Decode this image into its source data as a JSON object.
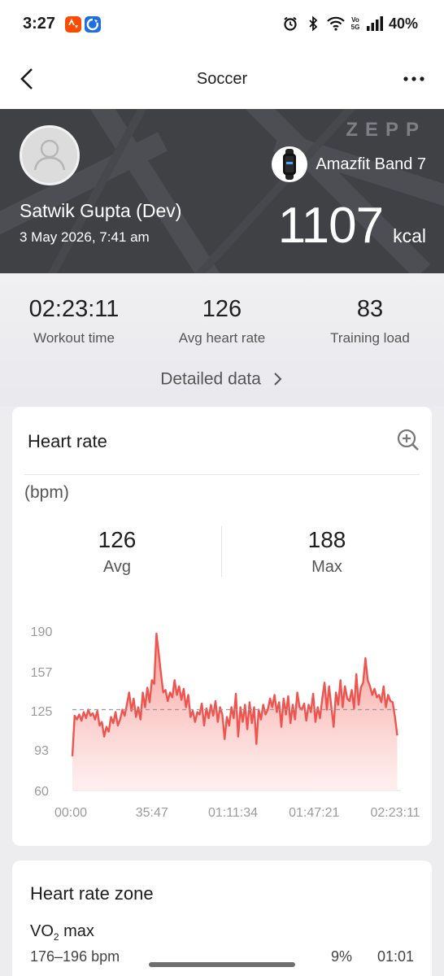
{
  "status_bar": {
    "time": "3:27",
    "icons": [
      "strava-notification-icon",
      "blue-app-notification-icon",
      "alarm-icon",
      "bluetooth-icon",
      "wifi-icon",
      "volte-icon",
      "signal-icon"
    ],
    "volte": "Vo\n5G",
    "battery": "40%"
  },
  "header": {
    "title": "Soccer",
    "back_icon": "chevron-left-icon",
    "more_icon": "more-icon"
  },
  "hero": {
    "brand": "ZEPP",
    "user_name": "Satwik Gupta (Dev)",
    "date": "3 May 2026, 7:41 am",
    "device_name": "Amazfit Band 7",
    "calories_value": "1107",
    "calories_unit": "kcal"
  },
  "summary": {
    "stats": [
      {
        "value": "02:23:11",
        "label": "Workout time"
      },
      {
        "value": "126",
        "label": "Avg heart rate"
      },
      {
        "value": "83",
        "label": "Training load"
      }
    ],
    "detailed_link": "Detailed data"
  },
  "heart_rate": {
    "title": "Heart rate",
    "unit": "(bpm)",
    "avg_value": "126",
    "avg_label": "Avg",
    "max_value": "188",
    "max_label": "Max"
  },
  "chart_data": {
    "type": "area",
    "title": "Heart rate",
    "ylabel": "(bpm)",
    "ylim": [
      60,
      190
    ],
    "yticks": [
      "190",
      "157",
      "125",
      "93",
      "60"
    ],
    "xticks": [
      "00:00",
      "35:47",
      "01:11:34",
      "01:47:21",
      "02:23:11"
    ],
    "x_range_minutes": [
      0,
      143.18
    ],
    "average_line": 126,
    "color": "#f0544f",
    "x": [
      0,
      1,
      2,
      3,
      4,
      5,
      6,
      7,
      8,
      9,
      10,
      11,
      12,
      13,
      14,
      15,
      16,
      17,
      18,
      19,
      20,
      21,
      22,
      23,
      24,
      25,
      26,
      27,
      28,
      29,
      30,
      31,
      32,
      33,
      34,
      35,
      36,
      37,
      38,
      39,
      40,
      41,
      42,
      43,
      44,
      45,
      46,
      47,
      48,
      49,
      50,
      51,
      52,
      53,
      54,
      55,
      56,
      57,
      58,
      59,
      60,
      61,
      62,
      63,
      64,
      65,
      66,
      67,
      68,
      69,
      70,
      71,
      72,
      73,
      74,
      75,
      76,
      77,
      78,
      79,
      80,
      81,
      82,
      83,
      84,
      85,
      86,
      87,
      88,
      89,
      90,
      91,
      92,
      93,
      94,
      95,
      96,
      97,
      98,
      99,
      100,
      101,
      102,
      103,
      104,
      105,
      106,
      107,
      108,
      109,
      110,
      111,
      112,
      113,
      114,
      115,
      116,
      117,
      118,
      119,
      120,
      121,
      122,
      123,
      124,
      125,
      126,
      127,
      128,
      129,
      130,
      131,
      132,
      133,
      134,
      135,
      136,
      137,
      138,
      139,
      140,
      141,
      142,
      143
    ],
    "values": [
      88,
      121,
      118,
      122,
      117,
      124,
      119,
      126,
      121,
      123,
      118,
      125,
      113,
      116,
      104,
      112,
      108,
      120,
      115,
      124,
      113,
      118,
      126,
      121,
      130,
      140,
      125,
      135,
      120,
      128,
      118,
      140,
      128,
      144,
      132,
      150,
      147,
      188,
      172,
      155,
      140,
      142,
      133,
      140,
      136,
      150,
      138,
      145,
      134,
      143,
      128,
      138,
      120,
      125,
      116,
      124,
      122,
      131,
      113,
      127,
      119,
      130,
      121,
      133,
      116,
      128,
      122,
      102,
      120,
      113,
      128,
      119,
      139,
      104,
      128,
      116,
      130,
      110,
      132,
      115,
      128,
      98,
      126,
      118,
      130,
      122,
      126,
      135,
      128,
      138,
      124,
      132,
      112,
      135,
      122,
      137,
      115,
      130,
      118,
      140,
      128,
      126,
      131,
      117,
      130,
      124,
      139,
      116,
      128,
      119,
      135,
      148,
      126,
      145,
      128,
      112,
      140,
      130,
      150,
      128,
      145,
      135,
      133,
      142,
      127,
      155,
      130,
      144,
      148,
      168,
      150,
      145,
      138,
      143,
      136,
      138,
      132,
      145,
      128,
      138,
      133,
      132,
      120,
      105
    ]
  },
  "zone_card": {
    "title": "Heart rate zone",
    "vo2_label": "VO",
    "vo2_sub": "2",
    "vo2_suffix": " max",
    "range": "176–196 bpm",
    "percent": "9%",
    "time": "01:01"
  }
}
